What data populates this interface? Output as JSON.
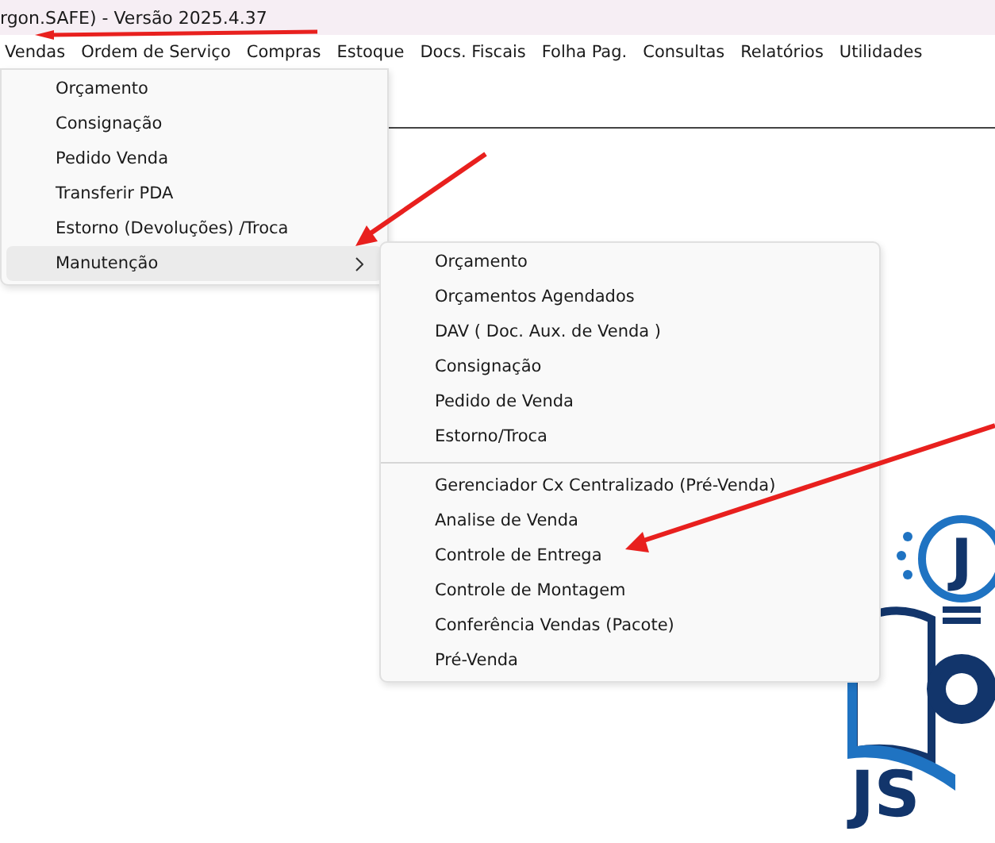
{
  "window": {
    "title": "rgon.SAFE) - Versão 2025.4.37"
  },
  "menubar": [
    "Vendas",
    "Ordem de Serviço",
    "Compras",
    "Estoque",
    "Docs. Fiscais",
    "Folha Pag.",
    "Consultas",
    "Relatórios",
    "Utilidades"
  ],
  "menu": {
    "items": [
      {
        "kind": "item",
        "label": "Orçamento",
        "selected": false
      },
      {
        "kind": "item",
        "label": "Consignação",
        "selected": false
      },
      {
        "kind": "item",
        "label": "Pedido Venda",
        "selected": false
      },
      {
        "kind": "item",
        "label": "Transferir PDA",
        "selected": false
      },
      {
        "kind": "item",
        "label": "Estorno (Devoluções) /Troca",
        "selected": false
      },
      {
        "kind": "submenu",
        "label": "Manutenção",
        "selected": true
      }
    ]
  },
  "submenu": {
    "items": [
      {
        "kind": "item",
        "label": "Orçamento",
        "selected": false
      },
      {
        "kind": "item",
        "label": "Orçamentos Agendados",
        "selected": false
      },
      {
        "kind": "item",
        "label": "DAV ( Doc. Aux. de Venda )",
        "selected": false
      },
      {
        "kind": "item",
        "label": "Consignação",
        "selected": false
      },
      {
        "kind": "item",
        "label": "Pedido de Venda",
        "selected": false
      },
      {
        "kind": "item",
        "label": "Estorno/Troca",
        "selected": false
      },
      {
        "kind": "separator"
      },
      {
        "kind": "item",
        "label": "Gerenciador Cx Centralizado (Pré-Venda)",
        "selected": false
      },
      {
        "kind": "item",
        "label": "Analise de Venda",
        "selected": false
      },
      {
        "kind": "item",
        "label": "Controle de Entrega",
        "selected": false
      },
      {
        "kind": "item",
        "label": "Controle de Montagem",
        "selected": false
      },
      {
        "kind": "item",
        "label": "Conferência Vendas (Pacote)",
        "selected": false
      },
      {
        "kind": "item",
        "label": "Pré-Venda",
        "selected": false
      }
    ]
  },
  "logo": {
    "bulb_letter": "J",
    "wordmark": "JS"
  }
}
